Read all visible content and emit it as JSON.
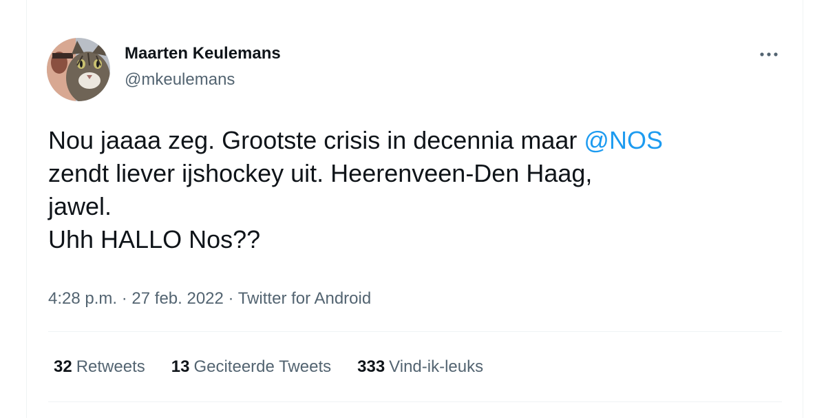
{
  "user": {
    "display_name": "Maarten Keulemans",
    "handle": "@mkeulemans"
  },
  "tweet": {
    "line1_text": "Nou jaaaa zeg. Grootste crisis in decennia maar ",
    "mention": "@NOS",
    "line2": "zendt liever ijshockey uit. Heerenveen-Den Haag,",
    "line3": "jawel.",
    "line4": "Uhh HALLO Nos??"
  },
  "meta": {
    "time": "4:28 p.m.",
    "separator": "·",
    "date": "27 feb. 2022",
    "source": "Twitter for Android"
  },
  "stats": {
    "retweets_count": "32",
    "retweets_label": "Retweets",
    "quotes_count": "13",
    "quotes_label": "Geciteerde Tweets",
    "likes_count": "333",
    "likes_label": "Vind-ik-leuks"
  },
  "icons": {
    "more": "more-horizontal-icon"
  },
  "colors": {
    "text_primary": "#0f1419",
    "text_secondary": "#536471",
    "mention": "#1d9bf0",
    "divider": "#eff3f4"
  }
}
